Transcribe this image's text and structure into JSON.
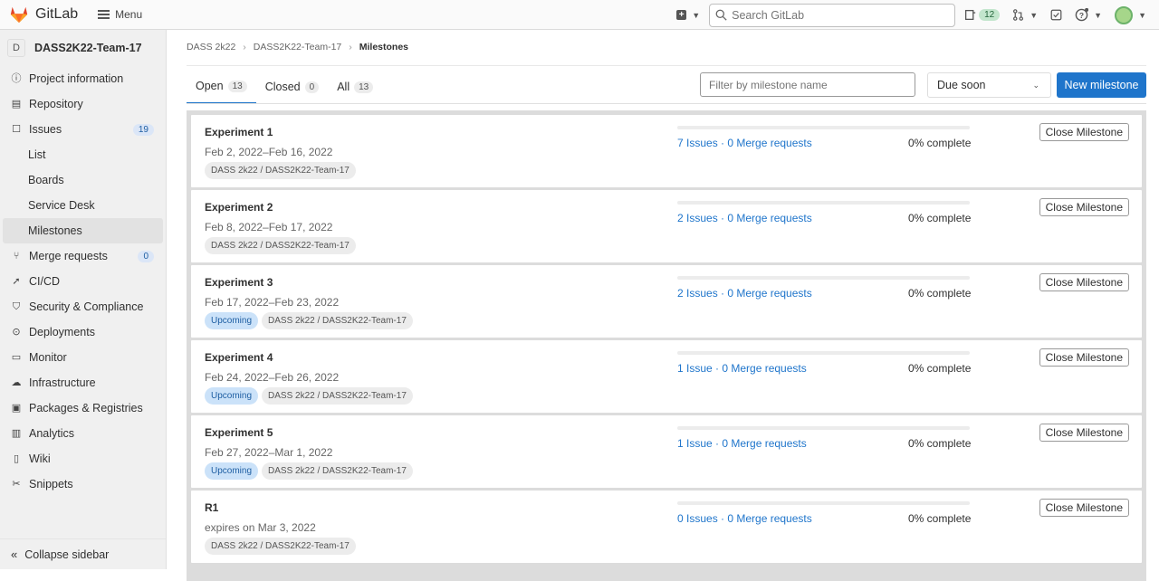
{
  "app": {
    "name": "GitLab",
    "menu_label": "Menu"
  },
  "header": {
    "search_placeholder": "Search GitLab",
    "issues_count": "12"
  },
  "sidebar": {
    "project_initial": "D",
    "project_name": "DASS2K22-Team-17",
    "items": [
      {
        "label": "Project information",
        "icon": "info-icon"
      },
      {
        "label": "Repository",
        "icon": "document-icon"
      },
      {
        "label": "Issues",
        "icon": "issues-icon",
        "badge": "19"
      },
      {
        "label": "List"
      },
      {
        "label": "Boards"
      },
      {
        "label": "Service Desk"
      },
      {
        "label": "Milestones"
      },
      {
        "label": "Merge requests",
        "icon": "merge-request-icon",
        "badge": "0"
      },
      {
        "label": "CI/CD",
        "icon": "rocket-icon"
      },
      {
        "label": "Security & Compliance",
        "icon": "shield-icon"
      },
      {
        "label": "Deployments",
        "icon": "deployments-icon"
      },
      {
        "label": "Monitor",
        "icon": "monitor-icon"
      },
      {
        "label": "Infrastructure",
        "icon": "cloud-icon"
      },
      {
        "label": "Packages & Registries",
        "icon": "package-icon"
      },
      {
        "label": "Analytics",
        "icon": "chart-icon"
      },
      {
        "label": "Wiki",
        "icon": "book-icon"
      },
      {
        "label": "Snippets",
        "icon": "scissors-icon"
      }
    ],
    "collapse_label": "Collapse sidebar"
  },
  "breadcrumb": [
    "DASS 2k22",
    "DASS2K22-Team-17",
    "Milestones"
  ],
  "tabs": [
    {
      "label": "Open",
      "count": "13"
    },
    {
      "label": "Closed",
      "count": "0"
    },
    {
      "label": "All",
      "count": "13"
    }
  ],
  "filter_placeholder": "Filter by milestone name",
  "sort_value": "Due soon",
  "new_button": "New milestone",
  "close_label": "Close Milestone",
  "milestones": [
    {
      "title": "Experiment 1",
      "date": "Feb 2, 2022–Feb 16, 2022",
      "upcoming": "",
      "path": "DASS 2k22 / DASS2K22-Team-17",
      "links": "7 Issues · 0 Merge requests",
      "pct": "0% complete"
    },
    {
      "title": "Experiment 2",
      "date": "Feb 8, 2022–Feb 17, 2022",
      "upcoming": "",
      "path": "DASS 2k22 / DASS2K22-Team-17",
      "links": "2 Issues · 0 Merge requests",
      "pct": "0% complete"
    },
    {
      "title": "Experiment 3",
      "date": "Feb 17, 2022–Feb 23, 2022",
      "upcoming": "Upcoming",
      "path": "DASS 2k22 / DASS2K22-Team-17",
      "links": "2 Issues · 0 Merge requests",
      "pct": "0% complete"
    },
    {
      "title": "Experiment 4",
      "date": "Feb 24, 2022–Feb 26, 2022",
      "upcoming": "Upcoming",
      "path": "DASS 2k22 / DASS2K22-Team-17",
      "links": "1 Issue · 0 Merge requests",
      "pct": "0% complete"
    },
    {
      "title": "Experiment 5",
      "date": "Feb 27, 2022–Mar 1, 2022",
      "upcoming": "Upcoming",
      "path": "DASS 2k22 / DASS2K22-Team-17",
      "links": "1 Issue · 0 Merge requests",
      "pct": "0% complete"
    },
    {
      "title": "R1",
      "date": "expires on Mar 3, 2022",
      "upcoming": "",
      "path": "DASS 2k22 / DASS2K22-Team-17",
      "links": "0 Issues · 0 Merge requests",
      "pct": "0% complete"
    }
  ],
  "colors": {
    "primary": "#1f75cb",
    "upcoming_bg": "#cbe2f9"
  }
}
